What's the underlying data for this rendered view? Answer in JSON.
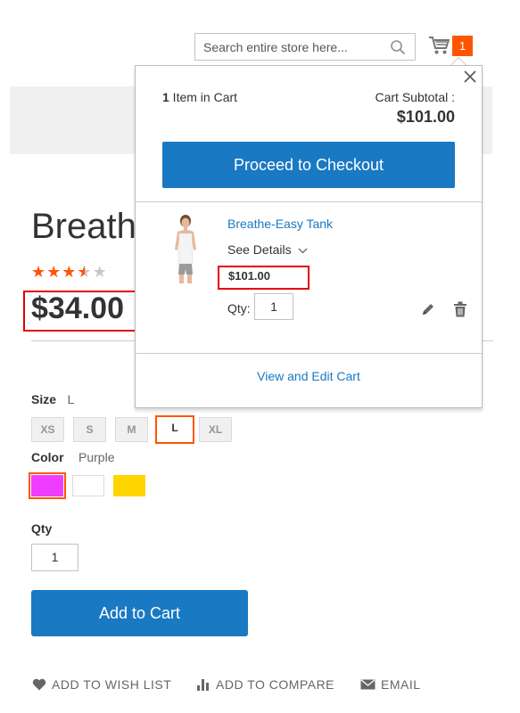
{
  "header": {
    "search_placeholder": "Search entire store here...",
    "cart_count": "1"
  },
  "product": {
    "title": "Breathe-Easy Tank",
    "rating_stars": "★★★",
    "rating_half": "★",
    "rating_empty": "★",
    "price": "$34.00"
  },
  "options": {
    "size_label": "Size",
    "size_value": "L",
    "sizes": [
      "XS",
      "S",
      "M",
      "L",
      "XL"
    ],
    "color_label": "Color",
    "color_value": "Purple",
    "colors": [
      "#ef3dff",
      "#ffffff",
      "#ffd500"
    ],
    "qty_label": "Qty",
    "qty_value": "1",
    "add_to_cart": "Add to Cart"
  },
  "actions": {
    "wishlist": "ADD TO WISH LIST",
    "compare": "ADD TO COMPARE",
    "email": "EMAIL"
  },
  "minicart": {
    "count_number": "1",
    "count_text": " Item in Cart",
    "subtotal_label": "Cart Subtotal :",
    "subtotal_value": "$101.00",
    "checkout": "Proceed to Checkout",
    "item_name": "Breathe-Easy Tank",
    "see_details": "See Details",
    "item_price": "$101.00",
    "qty_label": "Qty:",
    "qty_value": "1",
    "view_edit": "View and Edit Cart"
  },
  "colors": {
    "accent_blue": "#1979c3",
    "badge_orange": "#ff5501",
    "highlight_red": "#e40000"
  }
}
